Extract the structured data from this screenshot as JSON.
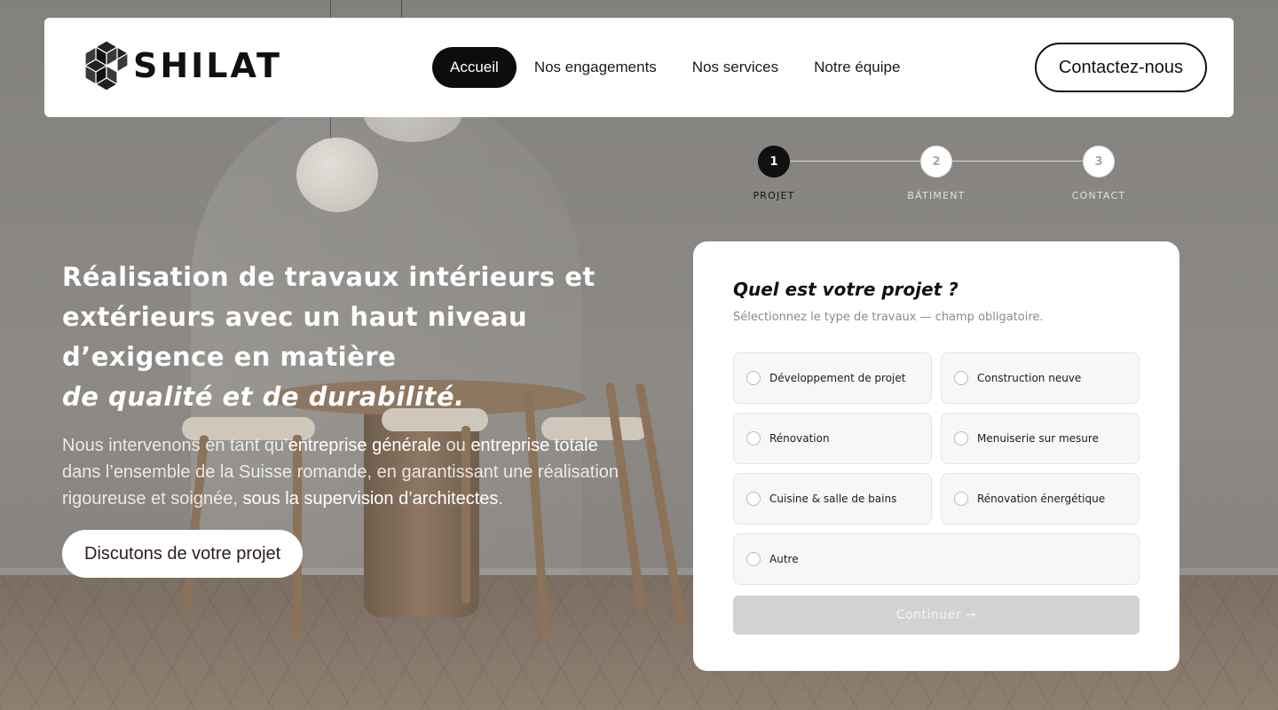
{
  "header": {
    "brand": "SHILAT",
    "nav": [
      {
        "label": "Accueil",
        "active": true
      },
      {
        "label": "Nos engagements",
        "active": false
      },
      {
        "label": "Nos services",
        "active": false
      },
      {
        "label": "Notre équipe",
        "active": false
      }
    ],
    "contact_label": "Contactez-nous"
  },
  "hero": {
    "title_line": "Réalisation de travaux intérieurs et extérieurs avec un haut niveau d’exigence en matière",
    "title_emphasis": "de qualité et de durabilité.",
    "desc_1": "Nous intervenons en tant qu’",
    "desc_hl_1": "entreprise générale",
    "desc_2": " ou ",
    "desc_hl_2": "entreprise totale",
    "desc_3": " dans l’ensemble de la Suisse romande, en garantissant une réalisation rigoureuse et soignée, ",
    "desc_hl_3": "sous la supervision d’architectes",
    "desc_4": ".",
    "cta_label": "Discutons de votre projet"
  },
  "stepper": {
    "steps": [
      {
        "number": "1",
        "label": "PROJET",
        "active": true
      },
      {
        "number": "2",
        "label": "BÂTIMENT",
        "active": false
      },
      {
        "number": "3",
        "label": "CONTACT",
        "active": false
      }
    ]
  },
  "form": {
    "title": "Quel est votre projet ?",
    "subtitle": "Sélectionnez le type de travaux — champ obligatoire.",
    "options": [
      "Développement de projet",
      "Construction neuve",
      "Rénovation",
      "Menuiserie sur mesure",
      "Cuisine & salle de bains",
      "Rénovation énergétique",
      "Autre"
    ],
    "continue_label": "Continuer →"
  },
  "colors": {
    "accent": "#0d0d0d",
    "card_bg": "#ffffff",
    "disabled_button": "#d2d2d2"
  }
}
